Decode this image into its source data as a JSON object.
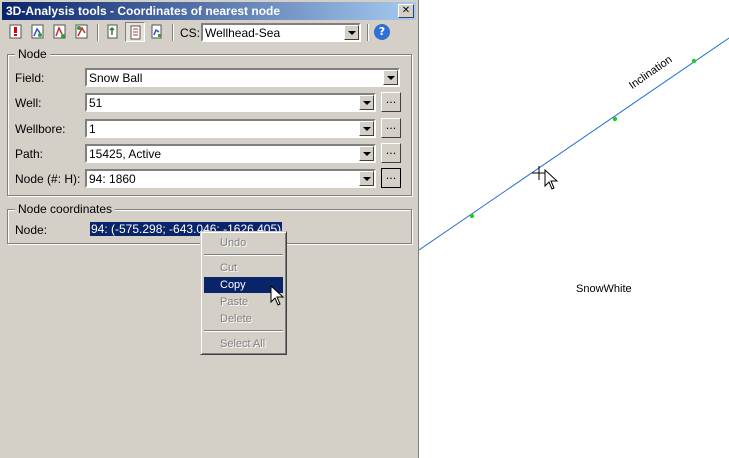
{
  "window": {
    "title": "3D-Analysis tools - Coordinates of nearest node",
    "close_glyph": "✕"
  },
  "toolbar": {
    "cs_label": "CS:",
    "cs_value": "Wellhead-Sea",
    "help_glyph": "?"
  },
  "node_group": {
    "title": "Node",
    "rows": [
      {
        "label": "Field:",
        "value": "Snow Ball"
      },
      {
        "label": "Well:",
        "value": "51"
      },
      {
        "label": "Wellbore:",
        "value": "1"
      },
      {
        "label": "Path:",
        "value": "15425, Active"
      },
      {
        "label": "Node (#: H):",
        "value": "94: 1860"
      }
    ],
    "browse_label": "..."
  },
  "coords_group": {
    "title": "Node coordinates",
    "label": "Node:",
    "value": "94: (-575.298; -643.046; -1626.405)"
  },
  "context_menu": {
    "items": [
      "Undo",
      "Cut",
      "Copy",
      "Paste",
      "Delete",
      "Select All"
    ]
  },
  "canvas": {
    "trajectory_label": "Inclination",
    "well_label": "SnowWhite",
    "line_color": "#1f6fd6",
    "node_color": "#22cc22"
  }
}
